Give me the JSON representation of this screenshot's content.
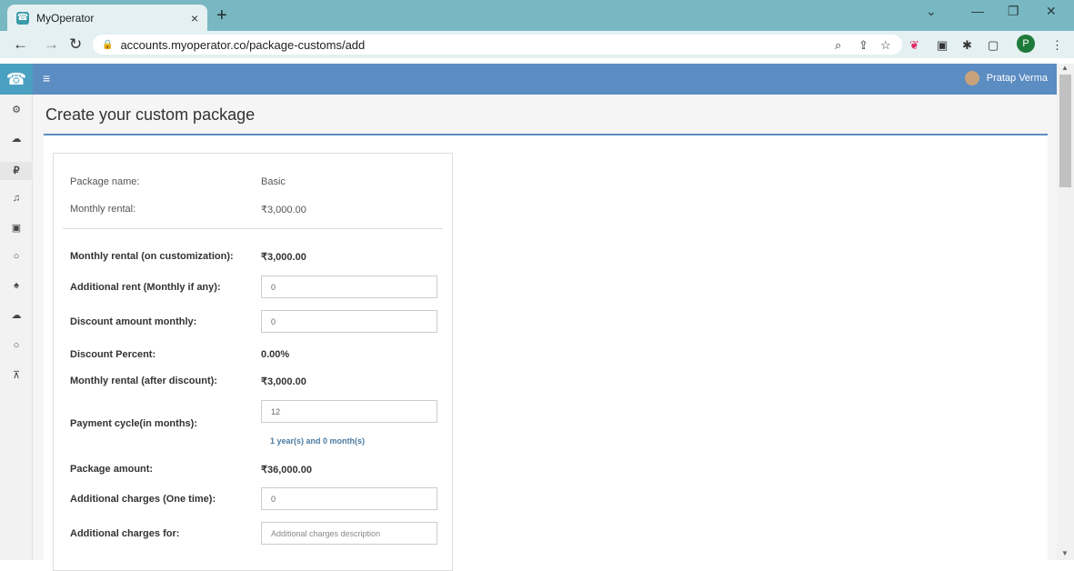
{
  "browser": {
    "tab_title": "MyOperator",
    "tab_close": "×",
    "new_tab": "+",
    "url": "accounts.myoperator.co/package-customs/add",
    "profile_initial": "P"
  },
  "header": {
    "menu_icon": "≡",
    "user_name": "Pratap Verma"
  },
  "page": {
    "title": "Create your custom package"
  },
  "form": {
    "package_name_label": "Package name:",
    "package_name_value": "Basic",
    "monthly_rental_label": "Monthly rental:",
    "monthly_rental_value": "₹3,000.00",
    "rental_custom_label": "Monthly rental (on customization):",
    "rental_custom_value": "₹3,000.00",
    "additional_rent_label": "Additional rent (Monthly if any):",
    "additional_rent_value": "0",
    "discount_amount_label": "Discount amount monthly:",
    "discount_amount_value": "0",
    "discount_percent_label": "Discount Percent:",
    "discount_percent_value": "0.00%",
    "rental_after_discount_label": "Monthly rental (after discount):",
    "rental_after_discount_value": "₹3,000.00",
    "payment_cycle_label": "Payment cycle(in months):",
    "payment_cycle_value": "12",
    "payment_cycle_hint": "1 year(s) and 0 month(s)",
    "package_amount_label": "Package amount:",
    "package_amount_value": "₹36,000.00",
    "additional_charges_label": "Additional charges (One time):",
    "additional_charges_value": "0",
    "additional_charges_for_label": "Additional charges for:",
    "additional_charges_for_placeholder": "Additional charges description"
  },
  "sidebar_icons": [
    "dashboard-icon",
    "cloud-icon",
    "rupee-icon",
    "headset-icon",
    "money-icon",
    "circle-icon",
    "bell-icon",
    "cloud-user-icon",
    "circle-icon-2",
    "cart-icon"
  ]
}
